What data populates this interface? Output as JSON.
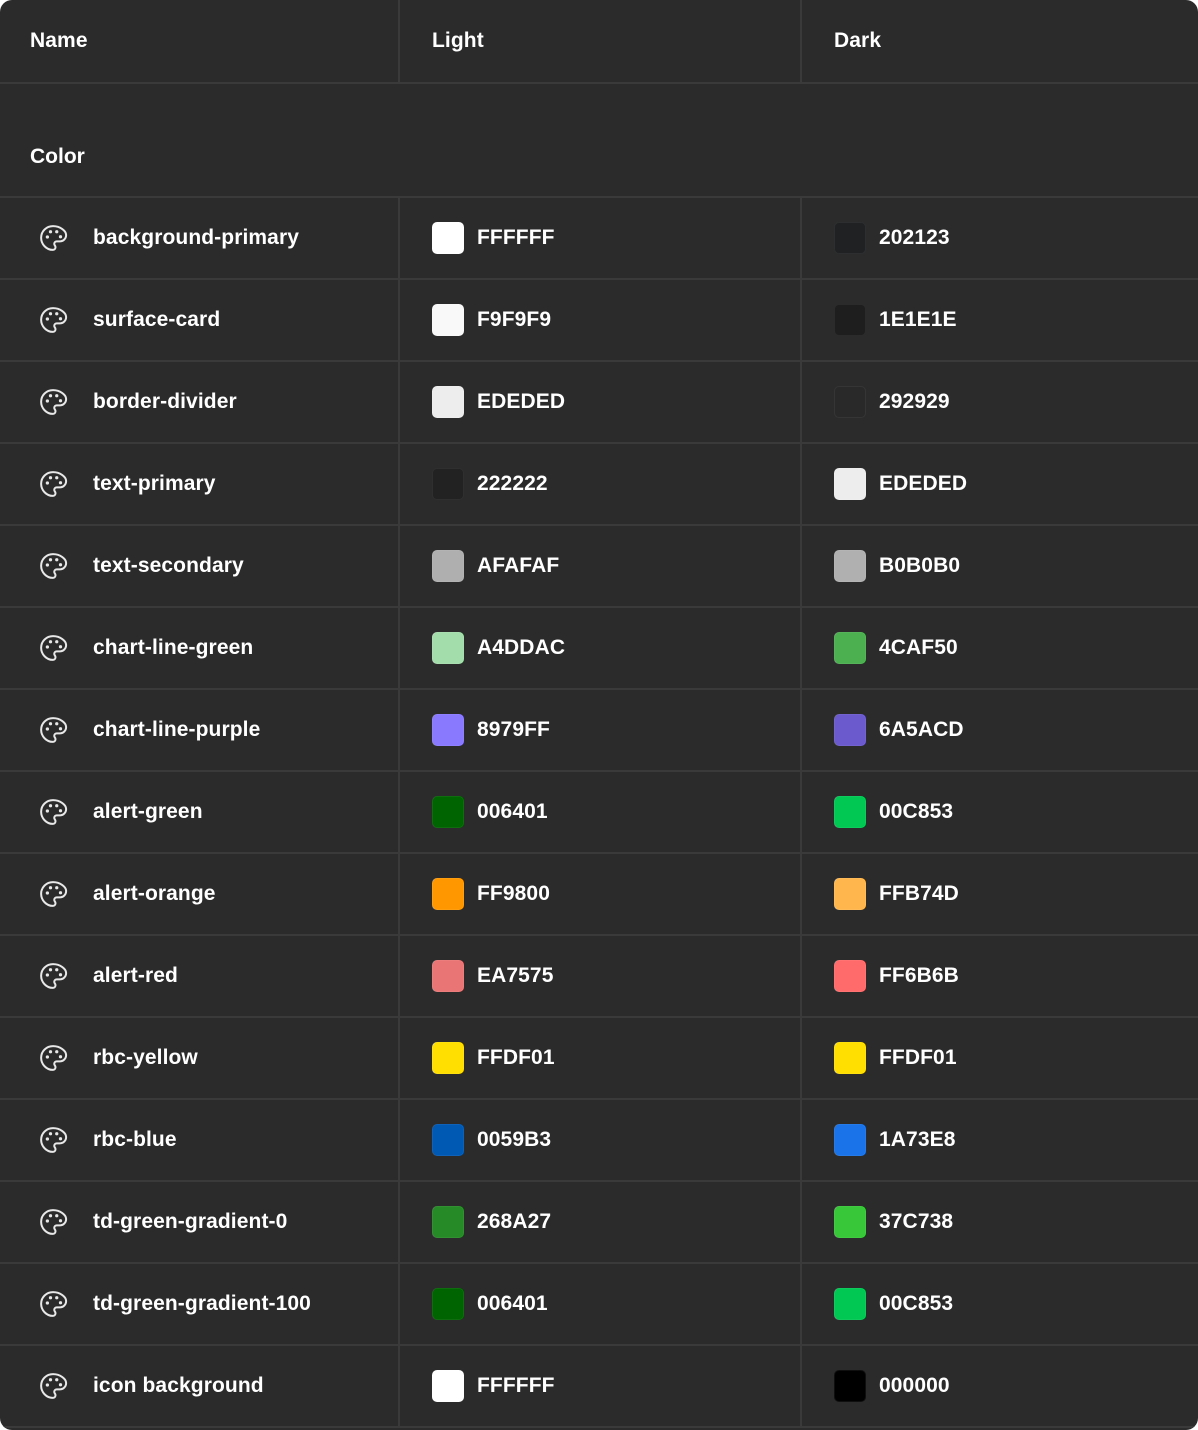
{
  "header": {
    "name": "Name",
    "light": "Light",
    "dark": "Dark"
  },
  "group": {
    "label": "Color"
  },
  "icon": "palette-icon",
  "rows": [
    {
      "name": "background-primary",
      "light": "FFFFFF",
      "light_color": "#FFFFFF",
      "dark": "202123",
      "dark_color": "#202123"
    },
    {
      "name": "surface-card",
      "light": "F9F9F9",
      "light_color": "#F9F9F9",
      "dark": "1E1E1E",
      "dark_color": "#1E1E1E"
    },
    {
      "name": "border-divider",
      "light": "EDEDED",
      "light_color": "#EDEDED",
      "dark": "292929",
      "dark_color": "#292929"
    },
    {
      "name": "text-primary",
      "light": "222222",
      "light_color": "#222222",
      "dark": "EDEDED",
      "dark_color": "#EDEDED"
    },
    {
      "name": "text-secondary",
      "light": "AFAFAF",
      "light_color": "#AFAFAF",
      "dark": "B0B0B0",
      "dark_color": "#B0B0B0"
    },
    {
      "name": "chart-line-green",
      "light": "A4DDAC",
      "light_color": "#A4DDAC",
      "dark": "4CAF50",
      "dark_color": "#4CAF50"
    },
    {
      "name": "chart-line-purple",
      "light": "8979FF",
      "light_color": "#8979FF",
      "dark": "6A5ACD",
      "dark_color": "#6A5ACD"
    },
    {
      "name": "alert-green",
      "light": "006401",
      "light_color": "#006401",
      "dark": "00C853",
      "dark_color": "#00C853"
    },
    {
      "name": "alert-orange",
      "light": "FF9800",
      "light_color": "#FF9800",
      "dark": "FFB74D",
      "dark_color": "#FFB74D"
    },
    {
      "name": "alert-red",
      "light": "EA7575",
      "light_color": "#EA7575",
      "dark": "FF6B6B",
      "dark_color": "#FF6B6B"
    },
    {
      "name": "rbc-yellow",
      "light": "FFDF01",
      "light_color": "#FFDF01",
      "dark": "FFDF01",
      "dark_color": "#FFDF01"
    },
    {
      "name": "rbc-blue",
      "light": "0059B3",
      "light_color": "#0059B3",
      "dark": "1A73E8",
      "dark_color": "#1A73E8"
    },
    {
      "name": "td-green-gradient-0",
      "light": "268A27",
      "light_color": "#268A27",
      "dark": "37C738",
      "dark_color": "#37C738"
    },
    {
      "name": "td-green-gradient-100",
      "light": "006401",
      "light_color": "#006401",
      "dark": "00C853",
      "dark_color": "#00C853"
    },
    {
      "name": "icon background",
      "light": "FFFFFF",
      "light_color": "#FFFFFF",
      "dark": "000000",
      "dark_color": "#000000"
    }
  ]
}
